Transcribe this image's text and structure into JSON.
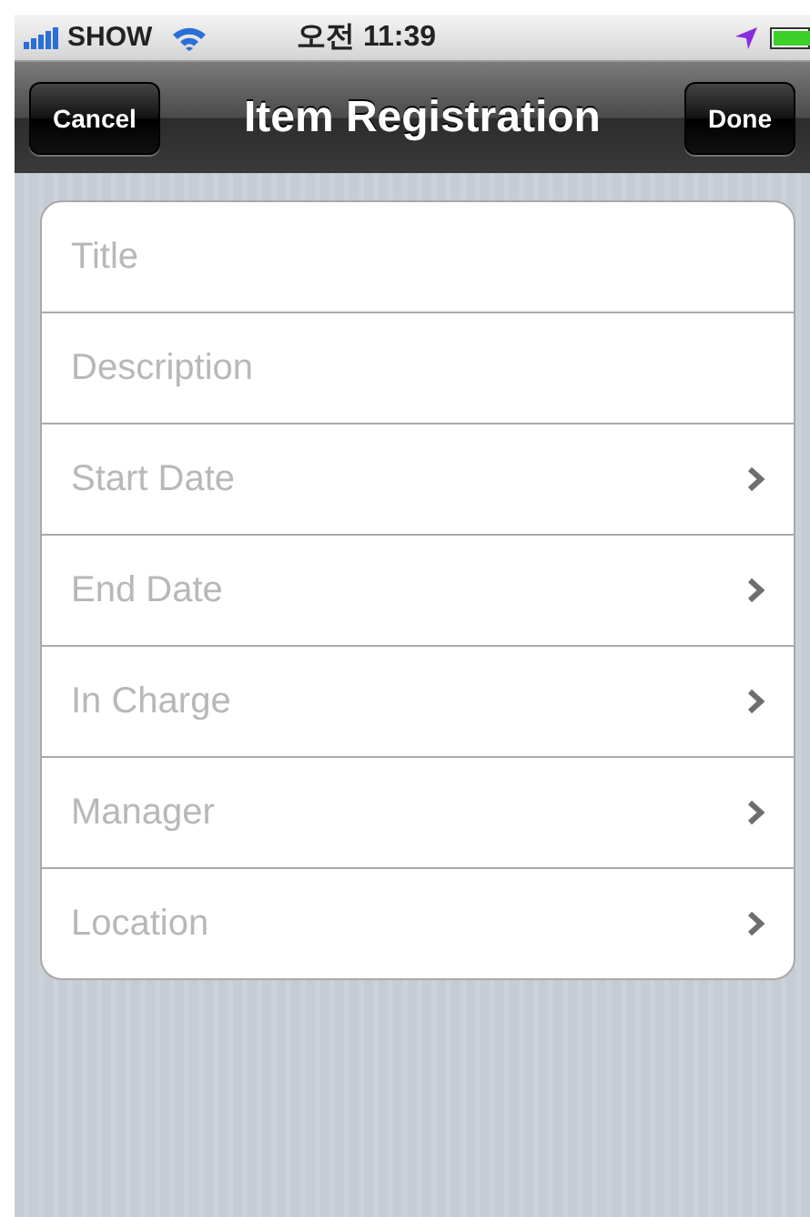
{
  "status_bar": {
    "carrier": "SHOW",
    "time": "오전 11:39"
  },
  "nav_bar": {
    "title": "Item Registration",
    "left_button": "Cancel",
    "right_button": "Done"
  },
  "rows": [
    {
      "kind": "field",
      "placeholder": "Title"
    },
    {
      "kind": "field",
      "placeholder": "Description"
    },
    {
      "kind": "disclosure",
      "label": "Start Date"
    },
    {
      "kind": "disclosure",
      "label": "End Date"
    },
    {
      "kind": "disclosure",
      "label": "In Charge"
    },
    {
      "kind": "disclosure",
      "label": "Manager"
    },
    {
      "kind": "disclosure",
      "label": "Location"
    }
  ]
}
